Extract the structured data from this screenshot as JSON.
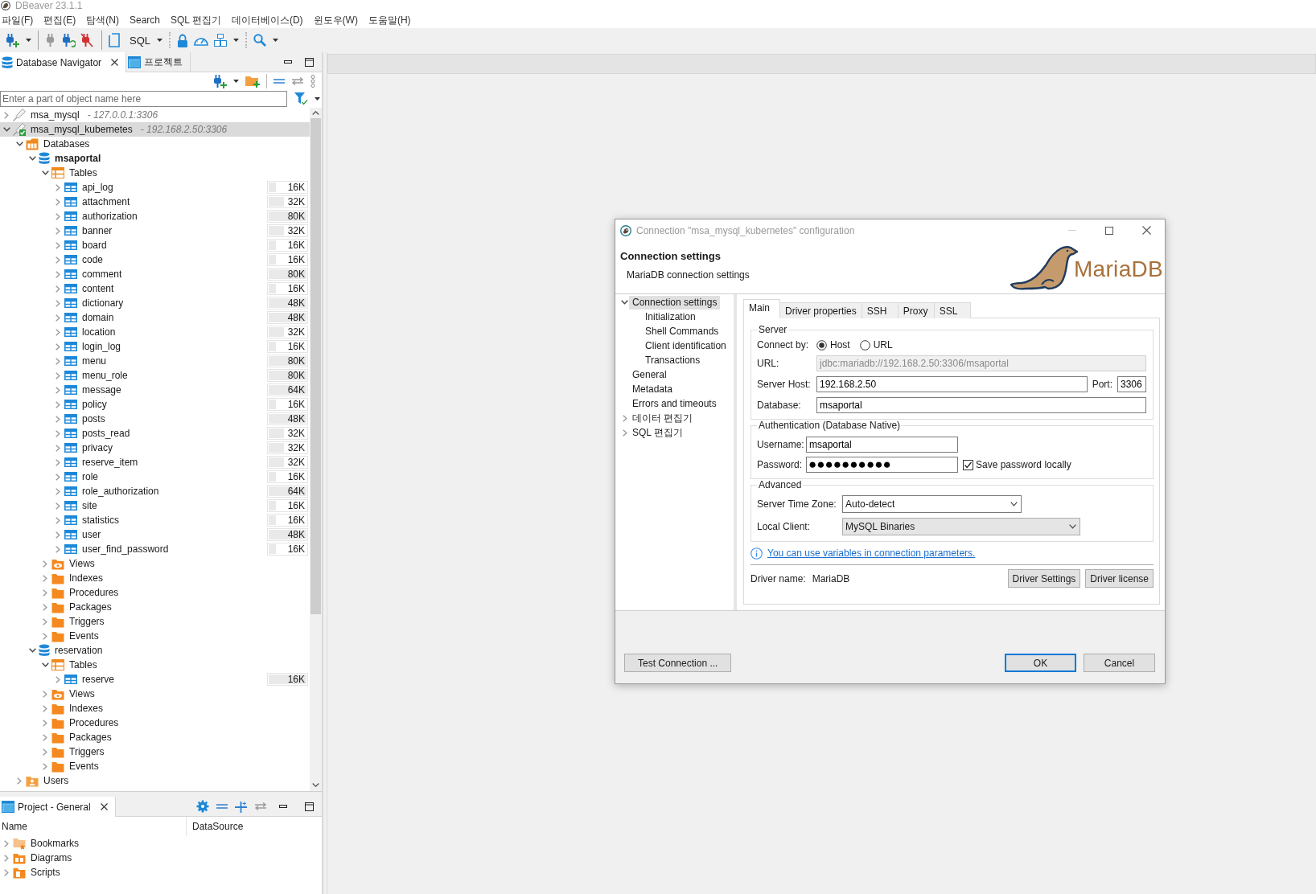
{
  "window": {
    "title": "DBeaver 23.1.1"
  },
  "menu": [
    "파일(F)",
    "편집(E)",
    "탐색(N)",
    "Search",
    "SQL 편집기",
    "데이터베이스(D)",
    "윈도우(W)",
    "도움말(H)"
  ],
  "toolbar": {
    "sql_label": "SQL"
  },
  "navigator": {
    "tabs": [
      {
        "kind": "database",
        "label": "Database Navigator",
        "selected": true
      },
      {
        "kind": "project",
        "label": "프로젝트",
        "selected": false
      }
    ],
    "filter": {
      "placeholder": "Enter a part of object name here"
    },
    "tree": [
      {
        "kind": "connection",
        "label": "msa_mysql",
        "host": "- 127.0.0.1:3306",
        "connected": false,
        "expanded": false,
        "selected": false
      },
      {
        "kind": "connection",
        "label": "msa_mysql_kubernetes",
        "host": "- 192.168.2.50:3306",
        "connected": true,
        "expanded": true,
        "selected": true,
        "children": [
          {
            "kind": "databases",
            "label": "Databases",
            "expanded": true,
            "selected": false,
            "children": [
              {
                "kind": "database",
                "label": "msaportal",
                "active": true,
                "expanded": true,
                "selected": false,
                "children": [
                  {
                    "kind": "tables",
                    "label": "Tables",
                    "expanded": true,
                    "selected": false,
                    "children": [
                      {
                        "kind": "table",
                        "label": "api_log",
                        "size": "16K",
                        "level": 0.2,
                        "expanded": false,
                        "selected": false
                      },
                      {
                        "kind": "table",
                        "label": "attachment",
                        "size": "32K",
                        "level": 0.4,
                        "expanded": false,
                        "selected": false
                      },
                      {
                        "kind": "table",
                        "label": "authorization",
                        "size": "80K",
                        "level": 1,
                        "expanded": false,
                        "selected": false
                      },
                      {
                        "kind": "table",
                        "label": "banner",
                        "size": "32K",
                        "level": 0.4,
                        "expanded": false,
                        "selected": false
                      },
                      {
                        "kind": "table",
                        "label": "board",
                        "size": "16K",
                        "level": 0.2,
                        "expanded": false,
                        "selected": false
                      },
                      {
                        "kind": "table",
                        "label": "code",
                        "size": "16K",
                        "level": 0.2,
                        "expanded": false,
                        "selected": false
                      },
                      {
                        "kind": "table",
                        "label": "comment",
                        "size": "80K",
                        "level": 1,
                        "expanded": false,
                        "selected": false
                      },
                      {
                        "kind": "table",
                        "label": "content",
                        "size": "16K",
                        "level": 0.2,
                        "expanded": false,
                        "selected": false
                      },
                      {
                        "kind": "table",
                        "label": "dictionary",
                        "size": "48K",
                        "level": 1,
                        "expanded": false,
                        "selected": false
                      },
                      {
                        "kind": "table",
                        "label": "domain",
                        "size": "48K",
                        "level": 1,
                        "expanded": false,
                        "selected": false
                      },
                      {
                        "kind": "table",
                        "label": "location",
                        "size": "32K",
                        "level": 0.4,
                        "expanded": false,
                        "selected": false
                      },
                      {
                        "kind": "table",
                        "label": "login_log",
                        "size": "16K",
                        "level": 0.2,
                        "expanded": false,
                        "selected": false
                      },
                      {
                        "kind": "table",
                        "label": "menu",
                        "size": "80K",
                        "level": 1,
                        "expanded": false,
                        "selected": false
                      },
                      {
                        "kind": "table",
                        "label": "menu_role",
                        "size": "80K",
                        "level": 1,
                        "expanded": false,
                        "selected": false
                      },
                      {
                        "kind": "table",
                        "label": "message",
                        "size": "64K",
                        "level": 1,
                        "expanded": false,
                        "selected": false
                      },
                      {
                        "kind": "table",
                        "label": "policy",
                        "size": "16K",
                        "level": 0.2,
                        "expanded": false,
                        "selected": false
                      },
                      {
                        "kind": "table",
                        "label": "posts",
                        "size": "48K",
                        "level": 1,
                        "expanded": false,
                        "selected": false
                      },
                      {
                        "kind": "table",
                        "label": "posts_read",
                        "size": "32K",
                        "level": 0.4,
                        "expanded": false,
                        "selected": false
                      },
                      {
                        "kind": "table",
                        "label": "privacy",
                        "size": "32K",
                        "level": 0.4,
                        "expanded": false,
                        "selected": false
                      },
                      {
                        "kind": "table",
                        "label": "reserve_item",
                        "size": "32K",
                        "level": 0.4,
                        "expanded": false,
                        "selected": false
                      },
                      {
                        "kind": "table",
                        "label": "role",
                        "size": "16K",
                        "level": 0.2,
                        "expanded": false,
                        "selected": false
                      },
                      {
                        "kind": "table",
                        "label": "role_authorization",
                        "size": "64K",
                        "level": 1,
                        "expanded": false,
                        "selected": false
                      },
                      {
                        "kind": "table",
                        "label": "site",
                        "size": "16K",
                        "level": 0.2,
                        "expanded": false,
                        "selected": false
                      },
                      {
                        "kind": "table",
                        "label": "statistics",
                        "size": "16K",
                        "level": 0.2,
                        "expanded": false,
                        "selected": false
                      },
                      {
                        "kind": "table",
                        "label": "user",
                        "size": "48K",
                        "level": 1,
                        "expanded": false,
                        "selected": false
                      },
                      {
                        "kind": "table",
                        "label": "user_find_password",
                        "size": "16K",
                        "level": 0.2,
                        "expanded": false,
                        "selected": false
                      }
                    ]
                  },
                  {
                    "kind": "views",
                    "label": "Views",
                    "expanded": false,
                    "selected": false
                  },
                  {
                    "kind": "folder",
                    "label": "Indexes",
                    "expanded": false,
                    "selected": false
                  },
                  {
                    "kind": "folder",
                    "label": "Procedures",
                    "expanded": false,
                    "selected": false
                  },
                  {
                    "kind": "folder",
                    "label": "Packages",
                    "expanded": false,
                    "selected": false
                  },
                  {
                    "kind": "folder",
                    "label": "Triggers",
                    "expanded": false,
                    "selected": false
                  },
                  {
                    "kind": "folder",
                    "label": "Events",
                    "expanded": false,
                    "selected": false
                  }
                ]
              },
              {
                "kind": "database",
                "label": "reservation",
                "active": false,
                "expanded": true,
                "selected": false,
                "children": [
                  {
                    "kind": "tables",
                    "label": "Tables",
                    "expanded": true,
                    "selected": false,
                    "children": [
                      {
                        "kind": "table",
                        "label": "reserve",
                        "size": "16K",
                        "level": 1,
                        "expanded": false,
                        "selected": false
                      }
                    ]
                  },
                  {
                    "kind": "views",
                    "label": "Views",
                    "expanded": false,
                    "selected": false
                  },
                  {
                    "kind": "folder",
                    "label": "Indexes",
                    "expanded": false,
                    "selected": false
                  },
                  {
                    "kind": "folder",
                    "label": "Procedures",
                    "expanded": false,
                    "selected": false
                  },
                  {
                    "kind": "folder",
                    "label": "Packages",
                    "expanded": false,
                    "selected": false
                  },
                  {
                    "kind": "folder",
                    "label": "Triggers",
                    "expanded": false,
                    "selected": false
                  },
                  {
                    "kind": "folder",
                    "label": "Events",
                    "expanded": false,
                    "selected": false
                  }
                ]
              }
            ]
          },
          {
            "kind": "users",
            "label": "Users",
            "expanded": false,
            "selected": false
          }
        ]
      }
    ]
  },
  "project_panel": {
    "tabs": [
      {
        "kind": "project",
        "label": "Project - General",
        "selected": true
      }
    ],
    "columns": [
      "Name",
      "DataSource"
    ],
    "items": [
      {
        "kind": "bookmarks",
        "label": "Bookmarks",
        "expanded": false,
        "selected": false
      },
      {
        "kind": "diagrams",
        "label": "Diagrams",
        "expanded": false,
        "selected": false
      },
      {
        "kind": "scripts",
        "label": "Scripts",
        "expanded": false,
        "selected": false
      }
    ]
  },
  "dialog": {
    "title": "Connection \"msa_mysql_kubernetes\" configuration",
    "header_title": "Connection settings",
    "header_subtitle": "MariaDB connection settings",
    "logo_text": "MariaDB",
    "nav": [
      {
        "label": "Connection settings",
        "expanded": true,
        "selected": true,
        "children": [
          {
            "label": "Initialization",
            "selected": false
          },
          {
            "label": "Shell Commands",
            "selected": false
          },
          {
            "label": "Client identification",
            "selected": false
          },
          {
            "label": "Transactions",
            "selected": false
          }
        ]
      },
      {
        "label": "General",
        "selected": false
      },
      {
        "label": "Metadata",
        "selected": false
      },
      {
        "label": "Errors and timeouts",
        "selected": false
      },
      {
        "label": "데이터 편집기",
        "expanded": false,
        "selected": false
      },
      {
        "label": "SQL 편집기",
        "expanded": false,
        "selected": false
      }
    ],
    "tabs": [
      {
        "label": "Main",
        "selected": true
      },
      {
        "label": "Driver properties",
        "selected": false
      },
      {
        "label": "SSH",
        "selected": false
      },
      {
        "label": "Proxy",
        "selected": false
      },
      {
        "label": "SSL",
        "selected": false
      }
    ],
    "server": {
      "legend": "Server",
      "connect_by": {
        "label": "Connect by:",
        "options": [
          {
            "label": "Host",
            "selected": true
          },
          {
            "label": "URL",
            "selected": false
          }
        ]
      },
      "url": {
        "label": "URL:",
        "value": "jdbc:mariadb://192.168.2.50:3306/msaportal",
        "disabled": true
      },
      "host": {
        "label": "Server Host:",
        "value": "192.168.2.50"
      },
      "port": {
        "label": "Port:",
        "value": "3306"
      },
      "database": {
        "label": "Database:",
        "value": "msaportal"
      }
    },
    "auth": {
      "legend": "Authentication (Database Native)",
      "username": {
        "label": "Username:",
        "value": "msaportal"
      },
      "password": {
        "label": "Password:",
        "value": "●●●●●●●●●●"
      },
      "save_password": {
        "label": "Save password locally",
        "checked": true
      }
    },
    "advanced": {
      "legend": "Advanced",
      "time_zone": {
        "label": "Server Time Zone:",
        "value": "Auto-detect",
        "read_only": false
      },
      "local_client": {
        "label": "Local Client:",
        "value": "MySQL Binaries",
        "read_only": true
      }
    },
    "info_link": "You can use variables in connection parameters.",
    "driver": {
      "label": "Driver name:",
      "value": "MariaDB",
      "buttons": [
        "Driver Settings",
        "Driver license"
      ]
    },
    "test_button": "Test Connection ...",
    "buttons": [
      {
        "label": "OK",
        "default": true
      },
      {
        "label": "Cancel",
        "default": false
      }
    ]
  }
}
